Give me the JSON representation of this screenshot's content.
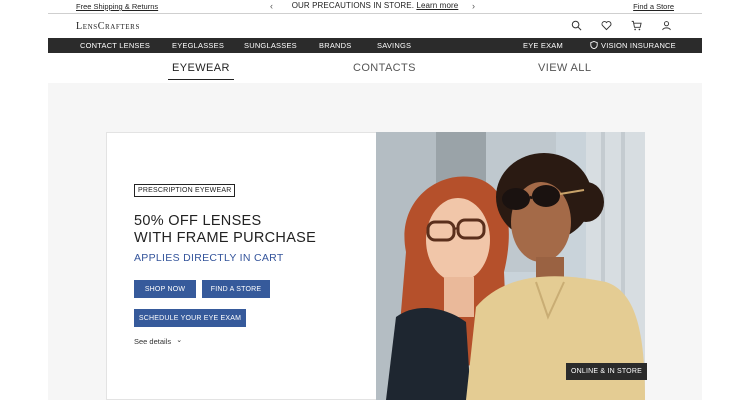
{
  "topbar": {
    "shipping_link": "Free Shipping & Returns",
    "announcement": "OUR PRECAUTIONS IN STORE.",
    "learn_more": "Learn more",
    "prev_arrow": "‹",
    "next_arrow": "›",
    "find_store_link": "Find a Store"
  },
  "header": {
    "logo": "LensCrafters",
    "icons": [
      "search-icon",
      "heart-icon",
      "cart-icon",
      "account-icon"
    ]
  },
  "nav": {
    "items": [
      "CONTACT LENSES",
      "EYEGLASSES",
      "SUNGLASSES",
      "BRANDS",
      "SAVINGS"
    ],
    "eye_exam": "EYE EXAM",
    "vision_insurance": "VISION INSURANCE"
  },
  "tabs": [
    {
      "label": "EYEWEAR",
      "active": true
    },
    {
      "label": "CONTACTS",
      "active": false
    },
    {
      "label": "VIEW ALL",
      "active": false
    }
  ],
  "promo": {
    "tag": "PRESCRIPTION EYEWEAR",
    "headline_line1": "50% OFF LENSES",
    "headline_line2": "WITH FRAME PURCHASE",
    "subhead": "APPLIES DIRECTLY IN CART",
    "shop_now": "SHOP NOW",
    "find_store": "FIND A STORE",
    "schedule_exam": "SCHEDULE YOUR EYE EXAM",
    "see_details": "See details",
    "see_details_chevron": "⌄"
  },
  "hero": {
    "badge": "ONLINE & IN STORE"
  },
  "colors": {
    "nav_bg": "#2b2b2b",
    "button_blue": "#365a9b",
    "subhead_blue": "#34549b"
  }
}
